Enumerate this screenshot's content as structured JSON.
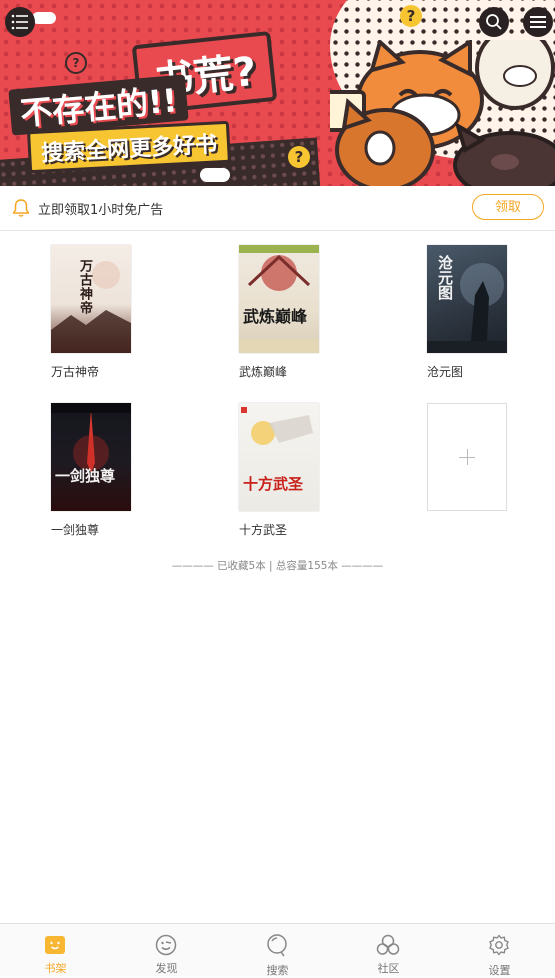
{
  "banner": {
    "headline": "书荒?",
    "subline": "不存在的!!",
    "tagline": "搜索全网更多好书",
    "qmark": "?",
    "colors": {
      "red": "#e94a4f",
      "dark": "#3a2b2b",
      "yellow": "#f7c531"
    }
  },
  "top_icons": {
    "left": "menu-list-icon",
    "search": "search-icon",
    "more": "menu-icon"
  },
  "notice": {
    "icon": "bell-icon",
    "text": "立即领取1小时免广告",
    "button": "领取"
  },
  "books": [
    {
      "title": "万古神帝",
      "cover_text": "万古神帝"
    },
    {
      "title": "武炼巅峰",
      "cover_text": "武炼巅峰"
    },
    {
      "title": "沧元图",
      "cover_text": "沧元图"
    },
    {
      "title": "一剑独尊",
      "cover_text": "一剑独尊"
    },
    {
      "title": "十方武圣",
      "cover_text": "十方武圣"
    }
  ],
  "add_book": {
    "icon": "plus-icon"
  },
  "summary": "———— 已收藏5本 | 总容量155本 ————",
  "bottom_nav": [
    {
      "label": "书架",
      "icon": "bookshelf-icon",
      "active": true
    },
    {
      "label": "发现",
      "icon": "discover-icon",
      "active": false
    },
    {
      "label": "搜索",
      "icon": "search-icon",
      "active": false
    },
    {
      "label": "社区",
      "icon": "community-icon",
      "active": false
    },
    {
      "label": "设置",
      "icon": "settings-gear-icon",
      "active": false
    }
  ],
  "accent_color": "#f5a623"
}
